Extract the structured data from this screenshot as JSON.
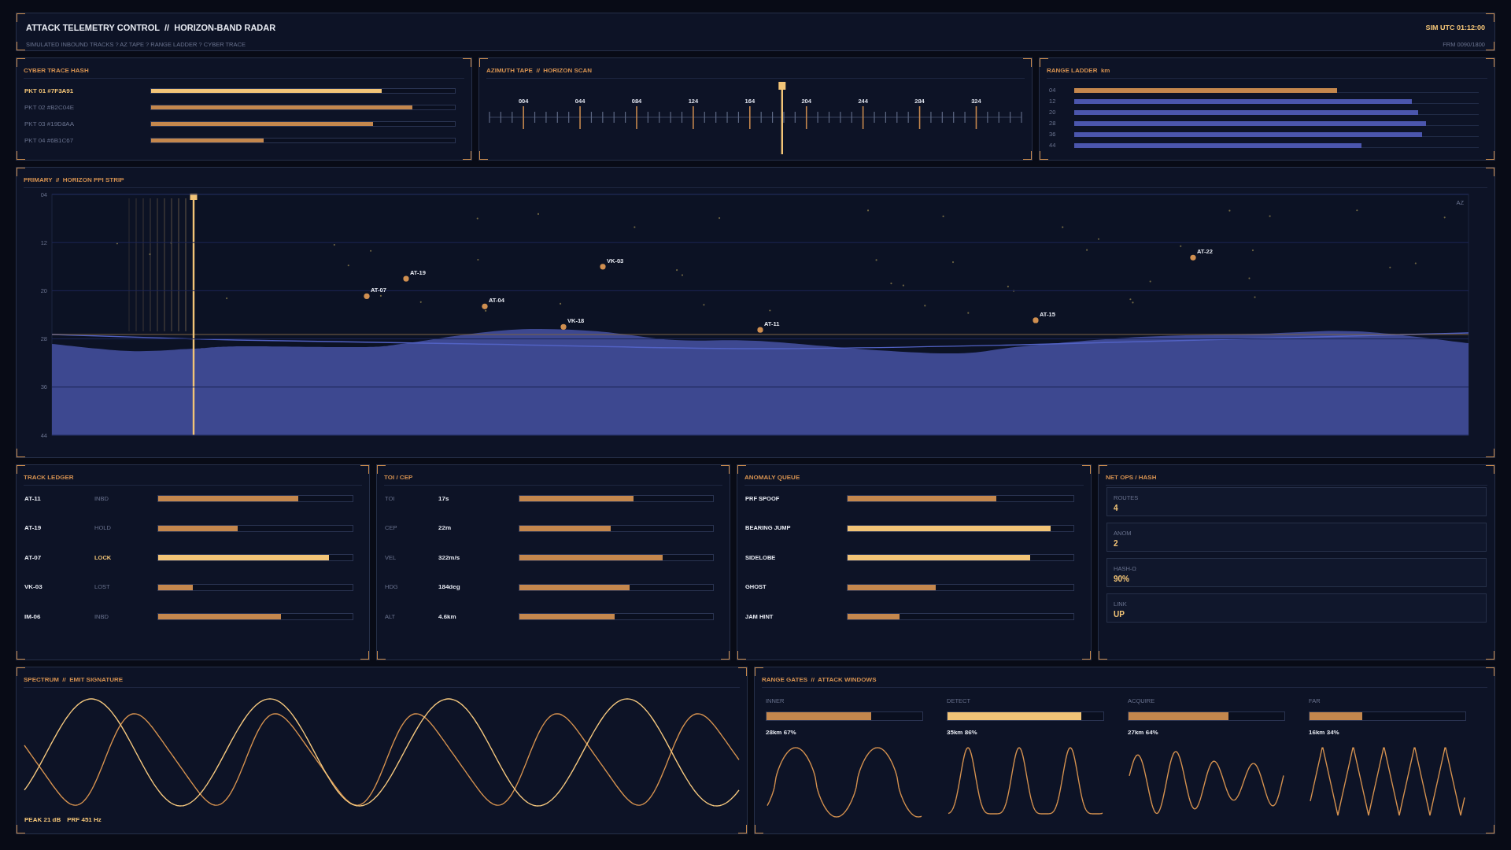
{
  "header": {
    "title": "ATTACK TELEMETRY CONTROL  //  HORIZON-BAND RADAR",
    "subtitle": "SIMULATED INBOUND TRACKS ? AZ TAPE ? RANGE LADDER ? CYBER TRACE",
    "clock": "SIM UTC 01:12:00",
    "frame": "FRM 0090/1800"
  },
  "cyber_trace": {
    "title": "CYBER TRACE HASH",
    "packets": [
      {
        "label": "PKT 01 #7F3A91",
        "level": 0.76,
        "selected": true
      },
      {
        "label": "PKT 02 #B2C04E",
        "level": 0.86,
        "selected": false
      },
      {
        "label": "PKT 03 #19D8AA",
        "level": 0.73,
        "selected": false
      },
      {
        "label": "PKT 04 #6B1C67",
        "level": 0.37,
        "selected": false
      }
    ]
  },
  "azimuth_tape": {
    "title": "AZIMUTH TAPE  //  HORIZON SCAN",
    "tick_labels": [
      "004",
      "044",
      "084",
      "124",
      "164",
      "204",
      "244",
      "284",
      "324"
    ],
    "cursor": {
      "level": 0.55
    }
  },
  "range_ladder": {
    "title": "RANGE LADDER  km",
    "rungs": [
      {
        "label": "04",
        "level": 0.65,
        "selected": true
      },
      {
        "label": "12",
        "level": 0.835,
        "selected": false
      },
      {
        "label": "20",
        "level": 0.85,
        "selected": false
      },
      {
        "label": "28",
        "level": 0.87,
        "selected": false
      },
      {
        "label": "36",
        "level": 0.86,
        "selected": false
      },
      {
        "label": "44",
        "level": 0.71,
        "selected": false
      }
    ]
  },
  "ppi_strip": {
    "title": "PRIMARY  //  HORIZON PPI STRIP",
    "corner_label": "AZ",
    "sweep": {
      "level": 0.1
    },
    "chart_data": {
      "type": "scatter",
      "grid": true,
      "ylim": [
        44,
        4
      ],
      "yticks": [
        {
          "value": 4,
          "label": "04"
        },
        {
          "value": 12,
          "label": "12"
        },
        {
          "value": 20,
          "label": "20"
        },
        {
          "value": 28,
          "label": "28"
        },
        {
          "value": 36,
          "label": "36"
        },
        {
          "value": 44,
          "label": "44"
        }
      ],
      "categories": [
        null,
        null,
        null,
        null,
        null,
        null,
        null,
        null,
        null,
        null,
        null,
        null,
        null,
        null,
        null,
        null,
        null,
        null,
        null,
        null,
        null,
        null,
        null,
        null,
        null,
        null,
        null,
        null,
        null,
        null,
        null,
        null,
        null,
        null,
        null,
        null,
        null
      ],
      "series": [
        {
          "color": "#d08f50",
          "values": [
            null,
            null,
            null,
            null,
            null,
            null,
            null,
            null,
            20.9,
            18.0,
            null,
            22.6,
            null,
            26.0,
            16.0,
            null,
            null,
            null,
            26.5,
            null,
            null,
            null,
            null,
            null,
            null,
            24.9,
            null,
            null,
            null,
            14.5,
            null,
            null,
            null,
            null,
            null,
            null,
            null
          ]
        }
      ],
      "value_labels": [
        null,
        null,
        null,
        null,
        null,
        null,
        null,
        null,
        "AT-07",
        "AT-19",
        null,
        "AT-04",
        null,
        "VK-18",
        "VK-03",
        null,
        null,
        null,
        "AT-11",
        null,
        null,
        null,
        null,
        null,
        null,
        "AT-15",
        null,
        null,
        null,
        "AT-22",
        null,
        null,
        null,
        null,
        null,
        null,
        null
      ]
    }
  },
  "track_ledger": {
    "title": "TRACK LEDGER",
    "tracks": [
      {
        "id": "AT-11",
        "status": "INBD",
        "level": 0.72,
        "selected": false
      },
      {
        "id": "AT-19",
        "status": "HOLD",
        "level": 0.41,
        "selected": false
      },
      {
        "id": "AT-07",
        "status": "LOCK",
        "level": 0.88,
        "selected": true
      },
      {
        "id": "VK-03",
        "status": "LOST",
        "level": 0.18,
        "selected": false
      },
      {
        "id": "IM-06",
        "status": "INBD",
        "level": 0.63,
        "selected": false
      }
    ]
  },
  "toi_cep": {
    "title": "TOI / CEP",
    "rows": [
      {
        "label": "TOI",
        "value": "17s",
        "level": 0.59
      },
      {
        "label": "CEP",
        "value": "22m",
        "level": 0.47
      },
      {
        "label": "VEL",
        "value": "322m/s",
        "level": 0.74
      },
      {
        "label": "HDG",
        "value": "184deg",
        "level": 0.57
      },
      {
        "label": "ALT",
        "value": "4.6km",
        "level": 0.49
      }
    ]
  },
  "anomaly_queue": {
    "title": "ANOMALY QUEUE",
    "items": [
      {
        "label": "PRF SPOOF",
        "level": 0.66,
        "alert": false
      },
      {
        "label": "BEARING JUMP",
        "level": 0.9,
        "alert": true
      },
      {
        "label": "SIDELOBE",
        "level": 0.81,
        "alert": true
      },
      {
        "label": "GHOST",
        "level": 0.39,
        "alert": false
      },
      {
        "label": "JAM HINT",
        "level": 0.23,
        "alert": false
      }
    ]
  },
  "net_ops": {
    "title": "NET OPS / HASH",
    "cards": [
      {
        "label": "ROUTES",
        "value": "4"
      },
      {
        "label": "ANOM",
        "value": "2"
      },
      {
        "label": "HASH-Ω",
        "value": "90%"
      },
      {
        "label": "LINK",
        "value": "UP"
      }
    ]
  },
  "spectrum": {
    "title": "SPECTRUM  //  EMIT SIGNATURE",
    "readouts": [
      "PEAK 21 dB",
      "PRF 451 Hz"
    ]
  },
  "range_gates": {
    "title": "RANGE GATES  //  ATTACK WINDOWS",
    "gates": [
      {
        "label": "INNER",
        "reading": "28km 67%",
        "level": 0.67,
        "selected": false
      },
      {
        "label": "DETECT",
        "reading": "35km 86%",
        "level": 0.86,
        "selected": true
      },
      {
        "label": "ACQUIRE",
        "reading": "27km 64%",
        "level": 0.64,
        "selected": false
      },
      {
        "label": "FAR",
        "reading": "16km 34%",
        "level": 0.34,
        "selected": false
      }
    ]
  }
}
